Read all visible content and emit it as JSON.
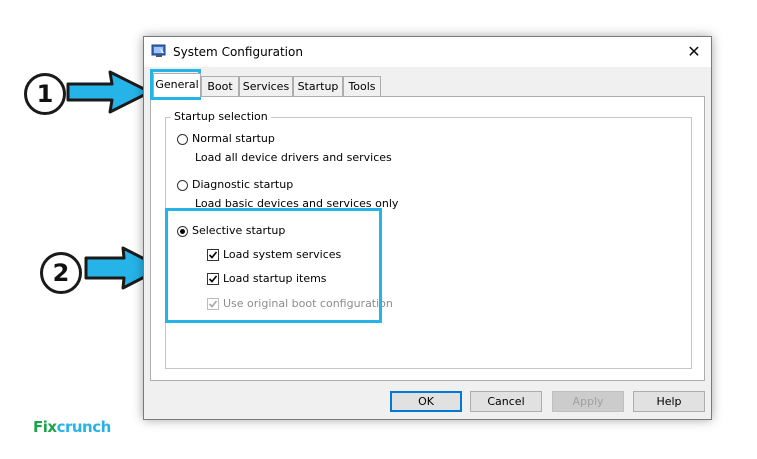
{
  "window": {
    "title": "System Configuration",
    "close_glyph": "✕"
  },
  "tabs": [
    {
      "label": "General",
      "active": true
    },
    {
      "label": "Boot"
    },
    {
      "label": "Services"
    },
    {
      "label": "Startup"
    },
    {
      "label": "Tools"
    }
  ],
  "startup_selection": {
    "legend": "Startup selection",
    "normal": {
      "label": "Normal startup",
      "description": "Load all device drivers and services",
      "selected": false
    },
    "diagnostic": {
      "label": "Diagnostic startup",
      "description": "Load basic devices and services only",
      "selected": false
    },
    "selective": {
      "label": "Selective startup",
      "selected": true,
      "options": [
        {
          "label": "Load system services",
          "checked": true,
          "enabled": true
        },
        {
          "label": "Load startup items",
          "checked": true,
          "enabled": true
        },
        {
          "label": "Use original boot configuration",
          "checked": true,
          "enabled": false
        }
      ]
    }
  },
  "buttons": {
    "ok": "OK",
    "cancel": "Cancel",
    "apply": "Apply",
    "help": "Help"
  },
  "annotations": {
    "step1": "1",
    "step2": "2",
    "highlight_color": "#26b3e8"
  },
  "logo": {
    "part1": "Fix",
    "part2": "crunch",
    "color_part1": "#1fa34a",
    "color_part2": "#26b3e8"
  }
}
